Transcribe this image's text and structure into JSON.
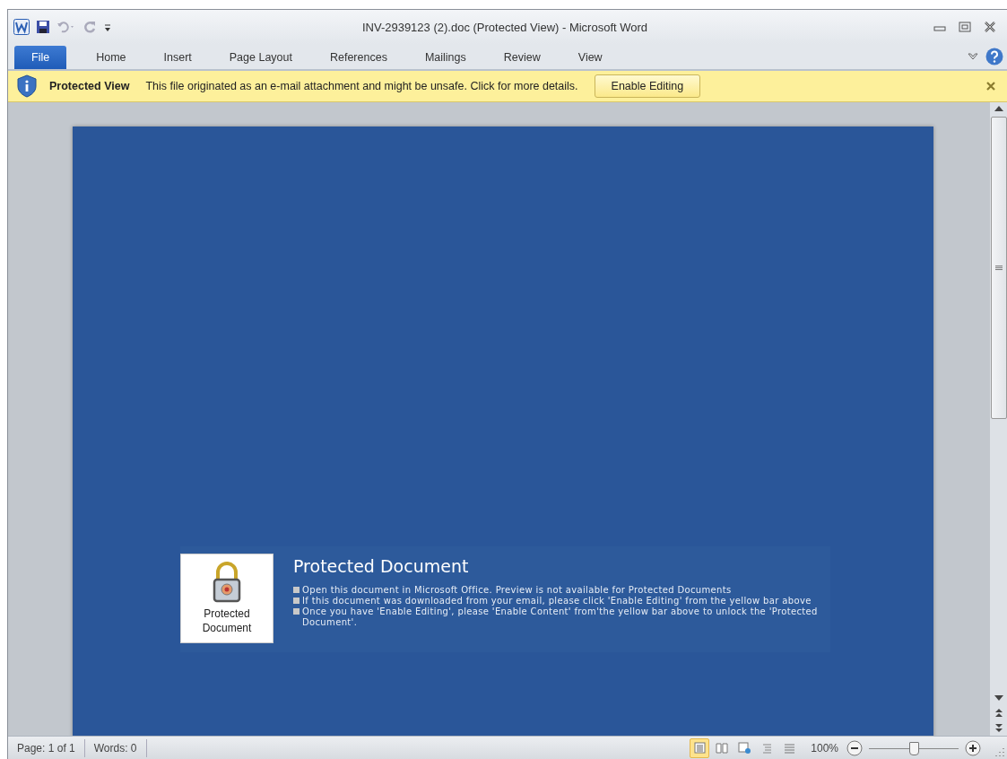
{
  "window": {
    "title": "INV-2939123 (2).doc (Protected View)  -  Microsoft Word"
  },
  "tabs": [
    {
      "label": "File",
      "selected": true
    },
    {
      "label": "Home",
      "selected": false
    },
    {
      "label": "Insert",
      "selected": false
    },
    {
      "label": "Page Layout",
      "selected": false
    },
    {
      "label": "References",
      "selected": false
    },
    {
      "label": "Mailings",
      "selected": false
    },
    {
      "label": "Review",
      "selected": false
    },
    {
      "label": "View",
      "selected": false
    }
  ],
  "message_bar": {
    "title": "Protected View",
    "message": "This file originated as an e-mail attachment and might be unsafe. Click for more details.",
    "button": "Enable Editing"
  },
  "notice": {
    "icon_label": "Protected Document",
    "heading": "Protected Document",
    "items": [
      "Open this document in Microsoft Office. Preview is not available for Protected Documents",
      "If this document was downloaded from your email, please click 'Enable Editing' from the yellow bar above",
      "Once you have 'Enable Editing', please 'Enable Content' from'the yellow bar above to unlock the 'Protected Document'."
    ]
  },
  "status_bar": {
    "page": "Page: 1 of 1",
    "words": "Words: 0",
    "views": [
      {
        "kind": "print",
        "selected": true
      },
      {
        "kind": "reading",
        "selected": false
      },
      {
        "kind": "web",
        "selected": false
      },
      {
        "kind": "outline",
        "selected": false
      },
      {
        "kind": "draft",
        "selected": false
      }
    ],
    "zoom": "100%",
    "zoom_slider": {
      "level": 0.5
    }
  }
}
